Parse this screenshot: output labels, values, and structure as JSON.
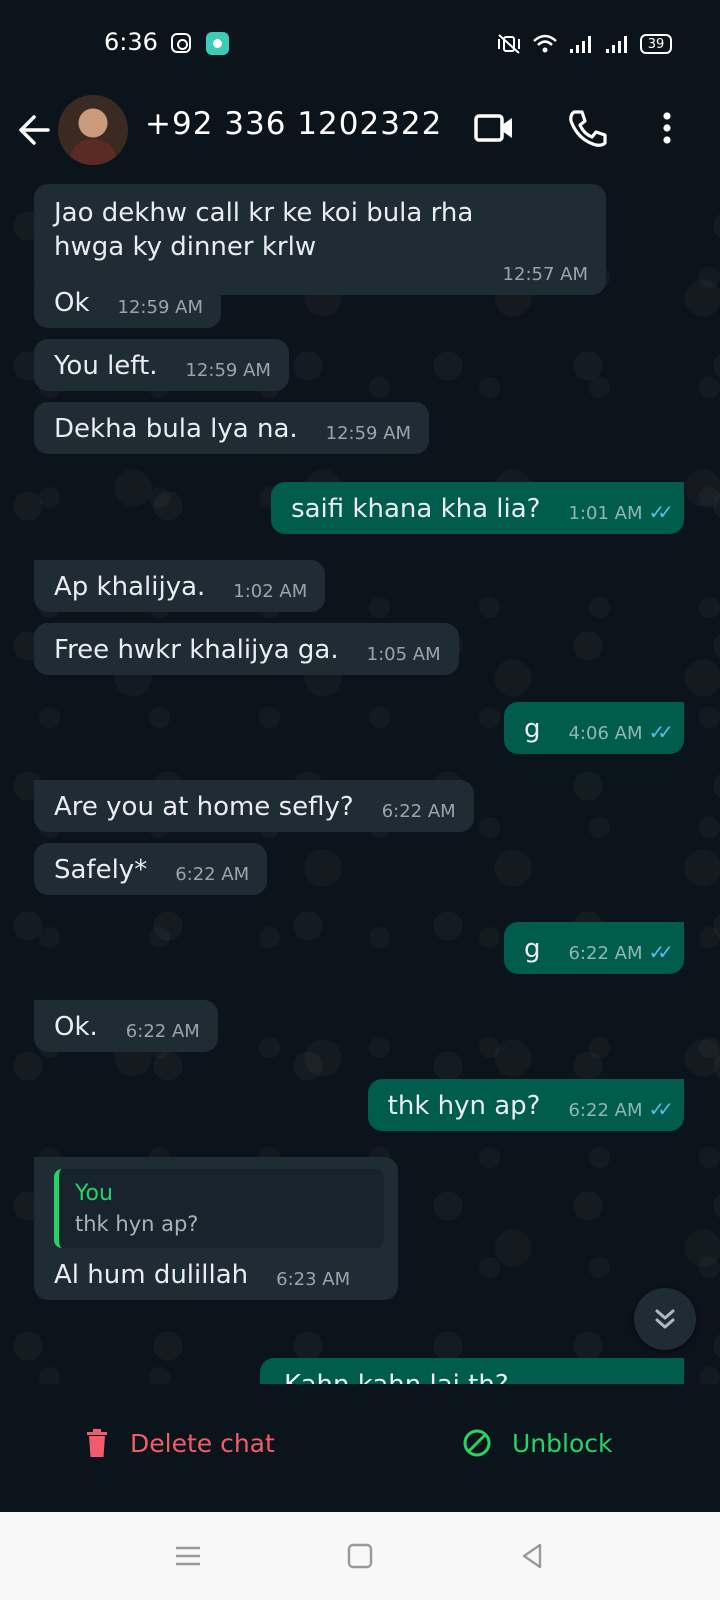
{
  "status_bar": {
    "time": "6:36",
    "battery": "39",
    "icons": [
      "instagram-icon",
      "app-notification-icon",
      "vibrate-off-icon",
      "wifi-icon",
      "signal-icon",
      "signal-icon-2",
      "battery-icon"
    ]
  },
  "header": {
    "contact_name": "+92 336 1202322",
    "icons": [
      "back-arrow-icon",
      "video-call-icon",
      "phone-call-icon",
      "more-options-icon"
    ]
  },
  "messages": [
    {
      "dir": "in",
      "text": "Jao dekhw call kr ke koi bula rha hwga ky dinner krlw",
      "time": "12:57 AM"
    },
    {
      "dir": "in",
      "text": "Ok",
      "time": "12:59 AM"
    },
    {
      "dir": "in",
      "text": "You left.",
      "time": "12:59 AM"
    },
    {
      "dir": "in",
      "text": "Dekha bula lya na.",
      "time": "12:59 AM"
    },
    {
      "dir": "out",
      "text": "saifi khana kha lia?",
      "time": "1:01 AM"
    },
    {
      "dir": "in",
      "text": "Ap khalijya.",
      "time": "1:02 AM"
    },
    {
      "dir": "in",
      "text": "Free hwkr khalijya ga.",
      "time": "1:05 AM"
    },
    {
      "dir": "out",
      "text": "g",
      "time": "4:06 AM"
    },
    {
      "dir": "in",
      "text": "Are you at home sefly?",
      "time": "6:22 AM"
    },
    {
      "dir": "in",
      "text": "Safely*",
      "time": "6:22 AM"
    },
    {
      "dir": "out",
      "text": "g",
      "time": "6:22 AM"
    },
    {
      "dir": "in",
      "text": "Ok.",
      "time": "6:22 AM"
    },
    {
      "dir": "out",
      "text": "thk hyn ap?",
      "time": "6:22 AM"
    },
    {
      "dir": "in",
      "text": "Al hum dulillah",
      "time": "6:23 AM",
      "quote_author": "You",
      "quote_text": "thk hyn ap?"
    },
    {
      "dir": "out",
      "text": "Kahn kahn lai th?",
      "time": ""
    }
  ],
  "actions": {
    "delete_label": "Delete chat",
    "unblock_label": "Unblock"
  },
  "colors": {
    "background": "#0b141a",
    "incoming_bubble": "#1f2c34",
    "outgoing_bubble": "#005c4b",
    "read_ticks": "#53bdeb",
    "delete": "#f15c6d",
    "unblock": "#25d366"
  }
}
